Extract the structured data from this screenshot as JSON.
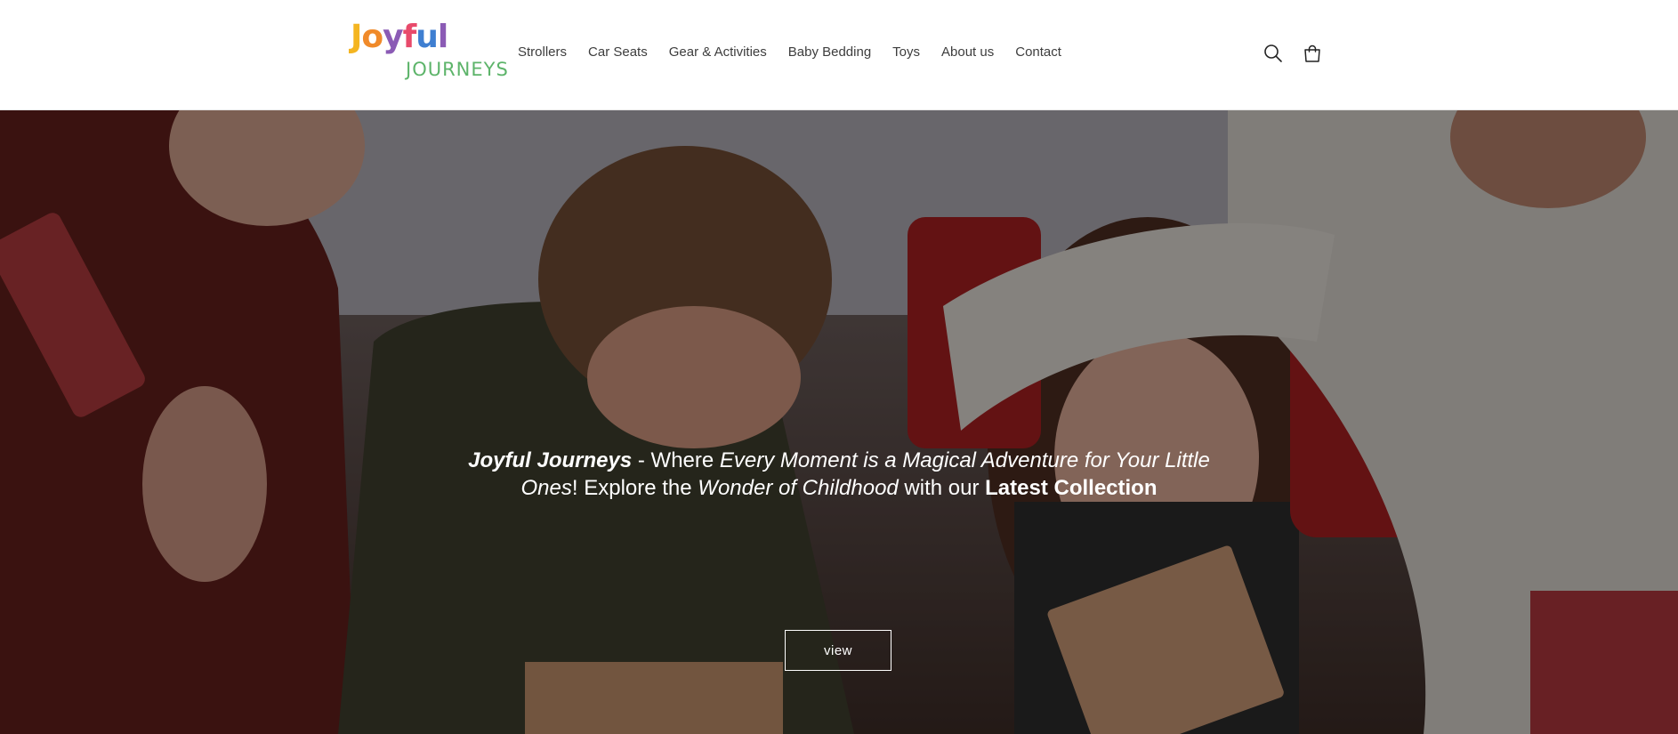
{
  "header": {
    "logo": {
      "line1": [
        "J",
        "o",
        "y",
        "f",
        "u",
        "l"
      ],
      "line2": "JOURNEYS",
      "line1_colors": [
        "#f4b521",
        "#f08a2a",
        "#8b5bb5",
        "#e84a6b",
        "#3f7fd1",
        "#8b5bb5"
      ],
      "line2_color": "#5db46a"
    },
    "nav": [
      {
        "label": "Strollers"
      },
      {
        "label": "Car Seats"
      },
      {
        "label": "Gear & Activities"
      },
      {
        "label": "Baby Bedding"
      },
      {
        "label": "Toys"
      },
      {
        "label": "About us"
      },
      {
        "label": "Contact"
      }
    ],
    "icons": {
      "search": "search-icon",
      "cart": "cart-icon"
    }
  },
  "hero": {
    "text": {
      "brand": "Joyful Journeys",
      "t1": " - Where ",
      "em1": "Every Moment is a Magical Adventure for Your Little Ones",
      "t2": "! Explore the ",
      "em2": "Wonder of Childhood",
      "t3": " with our ",
      "strong": "Latest Collection"
    },
    "button_label": "view"
  }
}
